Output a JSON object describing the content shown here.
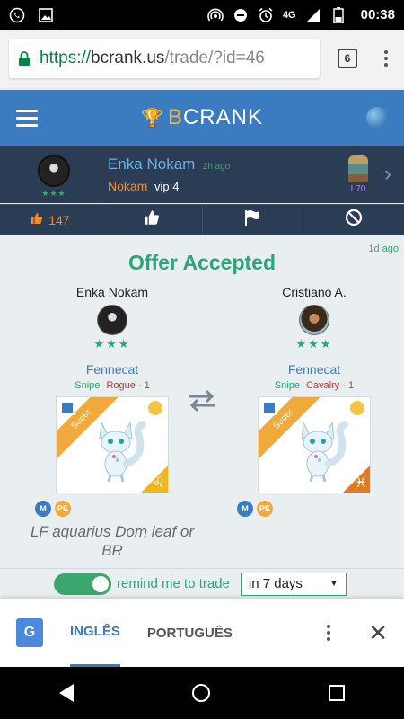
{
  "status_bar": {
    "network": "4G",
    "time": "00:38"
  },
  "browser": {
    "url_scheme": "https://",
    "url_host": "bcrank.us",
    "url_path": "/trade/?id=46",
    "tab_count": "6"
  },
  "site": {
    "brand_b": "B",
    "brand_rest": "CRANK"
  },
  "poster": {
    "name": "Enka Nokam",
    "time_ago": "2h ago",
    "game_name": "Nokam",
    "vip": "vip 4",
    "stars": "★★★",
    "level": "L70"
  },
  "actions": {
    "likes": "147"
  },
  "trade": {
    "status": "Offer Accepted",
    "time_ago": "1d ago",
    "left": {
      "user": "Enka Nokam",
      "stars": "★★★",
      "pet_name": "Fennecat",
      "tag1": "Snipe",
      "tag2": "Rogue · 1",
      "ribbon": "Super",
      "sign": "♌",
      "chip_m": "M",
      "chip_pe": "PE",
      "note": "LF aquarius Dom leaf or BR"
    },
    "right": {
      "user": "Cristiano A.",
      "stars": "★★★",
      "pet_name": "Fennecat",
      "tag1": "Snipe",
      "tag2": "Cavalry · 1",
      "ribbon": "Super",
      "sign": "♓",
      "chip_m": "M",
      "chip_pe": "PE"
    }
  },
  "reminder": {
    "label": "remind me to trade",
    "selected": "in 7 days"
  },
  "translate": {
    "lang_active": "INGLÊS",
    "lang_other": "PORTUGUÊS"
  },
  "colors": {
    "header_blue": "#3b7cc0",
    "dark_bar": "#2b3d55",
    "accent_green": "#2aa679",
    "accent_orange": "#f28b2f"
  }
}
